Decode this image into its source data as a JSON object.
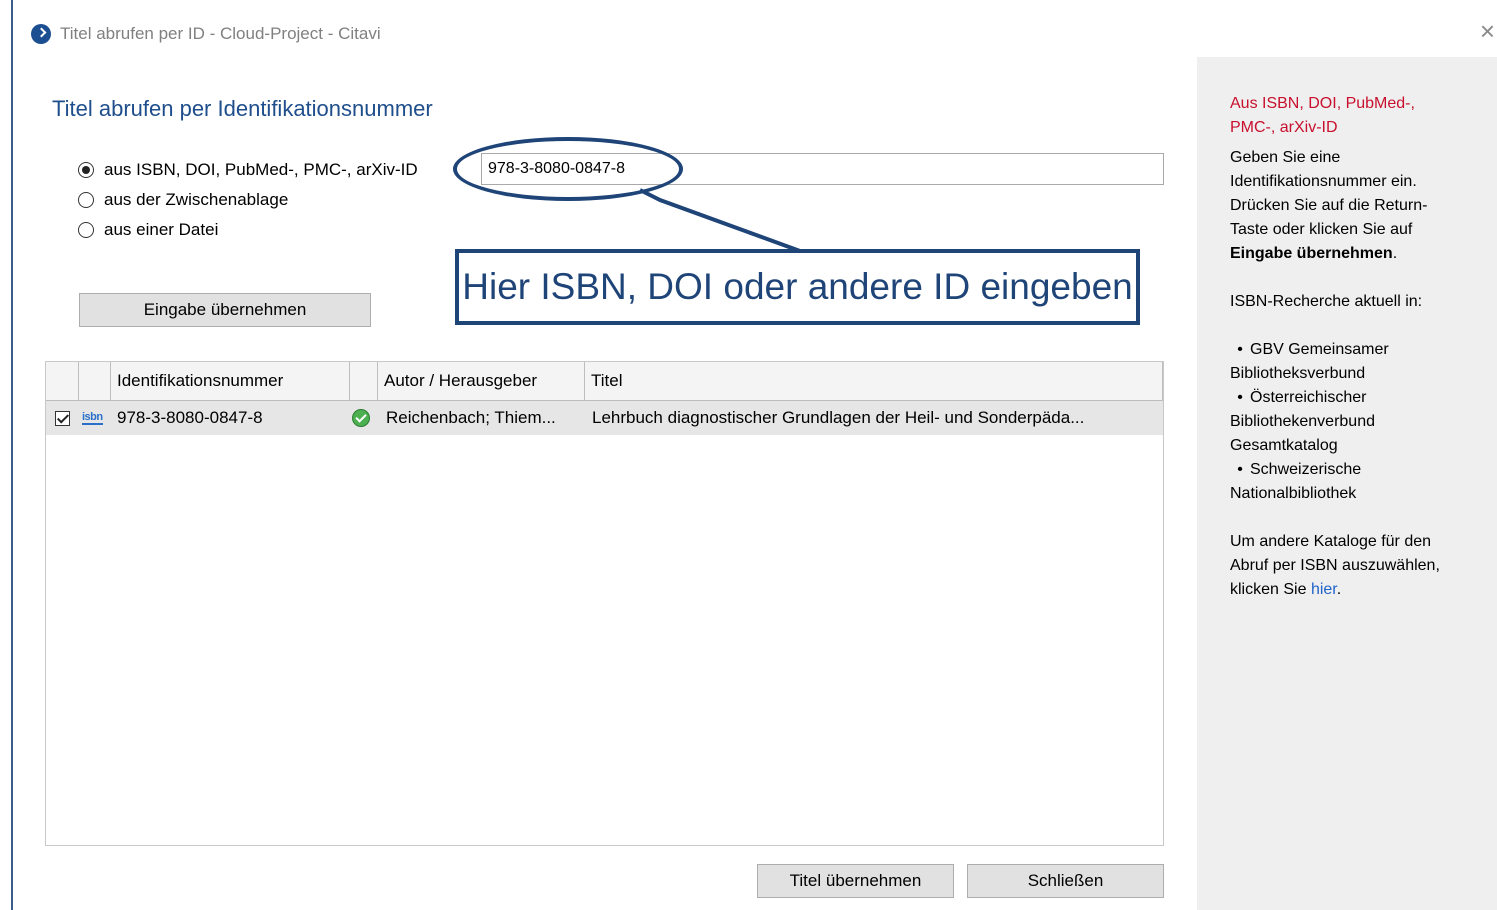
{
  "window": {
    "title": "Titel abrufen per ID - Cloud-Project - Citavi",
    "close_glyph": "×"
  },
  "main": {
    "heading": "Titel abrufen per Identifikationsnummer",
    "options": [
      {
        "label": "aus ISBN, DOI, PubMed-, PMC-, arXiv-ID",
        "checked": true
      },
      {
        "label": "aus der Zwischenablage",
        "checked": false
      },
      {
        "label": "aus einer Datei",
        "checked": false
      }
    ],
    "id_input_value": "978-3-8080-0847-8",
    "callout_text": "Hier ISBN, DOI oder andere ID eingeben",
    "apply_button": "Eingabe übernehmen"
  },
  "table": {
    "columns": [
      "",
      "",
      "Identifikationsnummer",
      "",
      "Autor / Herausgeber",
      "Titel"
    ],
    "rows": [
      {
        "checked": true,
        "type_icon": "isbn",
        "type_icon_label": "isbn",
        "id": "978-3-8080-0847-8",
        "status_icon": "check-circle",
        "author": "Reichenbach; Thiem...",
        "title": "Lehrbuch diagnostischer Grundlagen der Heil- und Sonderpäda..."
      }
    ]
  },
  "footer": {
    "import_button": "Titel übernehmen",
    "close_button": "Schließen"
  },
  "sidebar": {
    "heading_line1": "Aus ISBN, DOI, PubMed-,",
    "heading_line2": "PMC-, arXiv-ID",
    "instructions_line1": "Geben Sie eine",
    "instructions_line2": "Identifikationsnummer ein.",
    "instructions_line3": "Drücken Sie auf die Return-",
    "instructions_line4": "Taste oder klicken Sie auf",
    "instructions_bold": "Eingabe übernehmen",
    "instructions_end": ".",
    "isbn_heading": "ISBN-Recherche aktuell in:",
    "catalogs": [
      {
        "line1": "GBV Gemeinsamer",
        "line2": "Bibliotheksverbund",
        "line3": ""
      },
      {
        "line1": "Österreichischer",
        "line2": "Bibliothekenverbund",
        "line3": "Gesamtkatalog"
      },
      {
        "line1": "Schweizerische",
        "line2": "Nationalbibliothek",
        "line3": ""
      }
    ],
    "bullet": "•",
    "other_line1": "Um andere Kataloge für den",
    "other_line2": "Abruf per ISBN auszuwählen,",
    "other_line3_prefix": "klicken Sie",
    "other_link": "hier",
    "other_suffix": "."
  },
  "colors": {
    "accent_blue": "#1f4478",
    "heading_blue": "#1f4e8c",
    "sidebar_heading_red": "#c8102e",
    "link_blue": "#1f64c8",
    "sidebar_bg": "#efefef"
  }
}
